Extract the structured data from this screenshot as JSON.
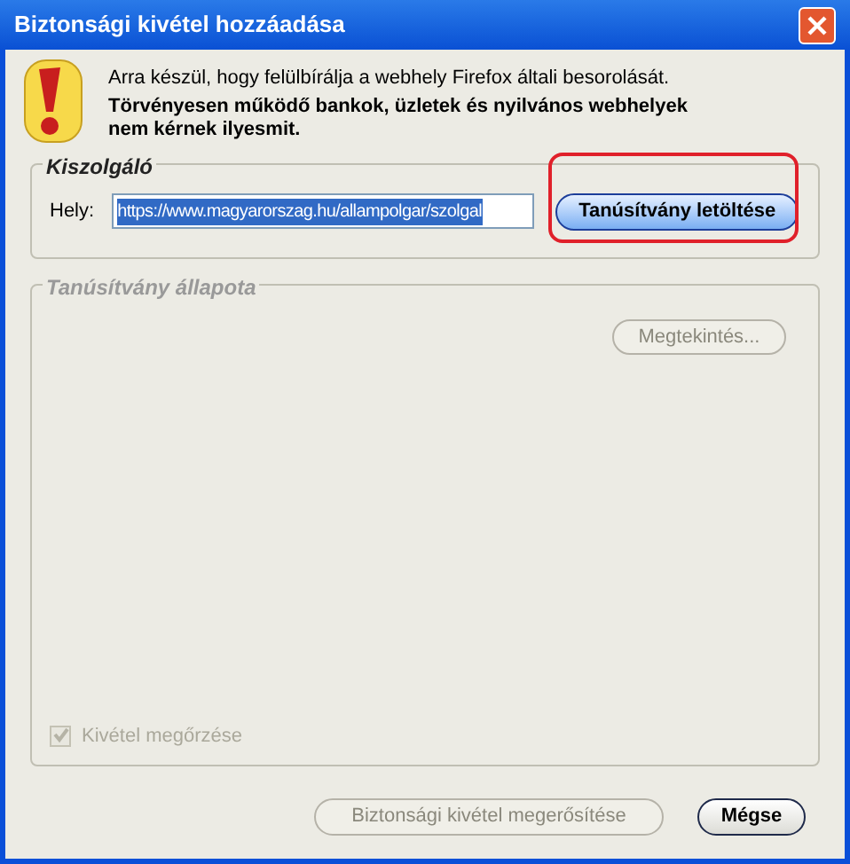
{
  "window": {
    "title": "Biztonsági kivétel hozzáadása"
  },
  "warning": {
    "message": "Arra készül, hogy felülbírálja a webhely Firefox általi besorolását.",
    "emphasis": "Törvényesen működő bankok, üzletek és nyilvános webhelyek nem kérnek ilyesmit."
  },
  "server": {
    "legend": "Kiszolgáló",
    "location_label": "Hely:",
    "url": "https://www.magyarorszag.hu/allampolgar/szolgal",
    "download_button": {
      "label": "Tanúsítvány letöltése",
      "highlighted": true
    }
  },
  "status": {
    "legend": "Tanúsítvány állapota",
    "view_button": {
      "label": "Megtekintés...",
      "disabled": true
    }
  },
  "remember": {
    "label": "Kivétel megőrzése",
    "checked": true,
    "disabled": true
  },
  "buttons": [
    {
      "label": "Biztonsági kivétel megerősítése",
      "disabled": true
    },
    {
      "label": "Mégse",
      "disabled": false
    }
  ]
}
